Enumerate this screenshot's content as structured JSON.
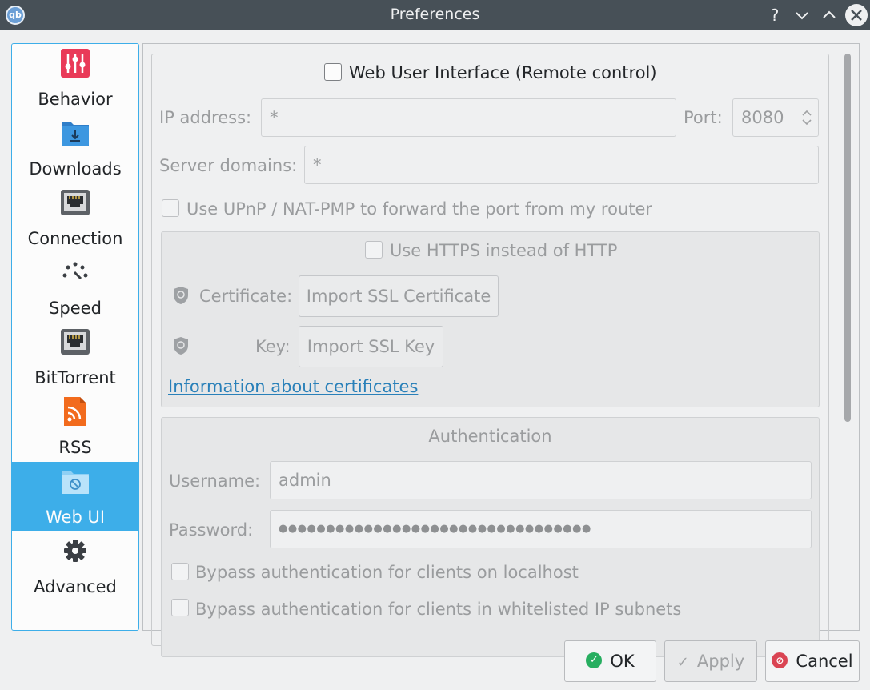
{
  "window": {
    "title": "Preferences",
    "app_icon_text": "qb",
    "help_glyph": "?",
    "minimize_glyph": "⌄",
    "maximize_glyph": "⌃",
    "close_glyph": "✕"
  },
  "sidebar": {
    "items": [
      {
        "label": "Behavior",
        "icon": "behavior-icon",
        "color": "#e93a58"
      },
      {
        "label": "Downloads",
        "icon": "downloads-folder-icon",
        "color": "#3d8fd6"
      },
      {
        "label": "Connection",
        "icon": "network-port-icon",
        "color": "#5d6166"
      },
      {
        "label": "Speed",
        "icon": "speedometer-icon",
        "color": "#3b3f44"
      },
      {
        "label": "BitTorrent",
        "icon": "network-port-icon",
        "color": "#5d6166"
      },
      {
        "label": "RSS",
        "icon": "rss-feed-icon",
        "color": "#f26b1d"
      },
      {
        "label": "Web UI",
        "icon": "webui-folder-icon",
        "color": "#ffffff"
      },
      {
        "label": "Advanced",
        "icon": "gear-icon",
        "color": "#3b3f44"
      }
    ],
    "active_index": 6
  },
  "webui": {
    "enable_label": "Web User Interface (Remote control)",
    "enable_checked": false,
    "ip_label": "IP address:",
    "ip_value": "*",
    "port_label": "Port:",
    "port_value": "8080",
    "domains_label": "Server domains:",
    "domains_value": "*",
    "upnp_label": "Use UPnP / NAT-PMP to forward the port from my router",
    "https": {
      "label": "Use HTTPS instead of HTTP",
      "cert_label": "Certificate:",
      "cert_button": "Import SSL Certificate",
      "key_label": "Key:",
      "key_button": "Import SSL Key",
      "info_link": "Information about certificates"
    },
    "auth": {
      "title": "Authentication",
      "username_label": "Username:",
      "username_value": "admin",
      "password_label": "Password:",
      "password_value": "●●●●●●●●●●●●●●●●●●●●●●●●●●●●●●●●●",
      "bypass_localhost_label": "Bypass authentication for clients on localhost",
      "bypass_whitelist_label": "Bypass authentication for clients in whitelisted IP subnets"
    }
  },
  "buttons": {
    "ok": "OK",
    "apply": "Apply",
    "cancel": "Cancel"
  },
  "colors": {
    "accent": "#3daee9",
    "ok_green": "#27ae60",
    "cancel_red": "#da4453",
    "link": "#2980b9"
  }
}
